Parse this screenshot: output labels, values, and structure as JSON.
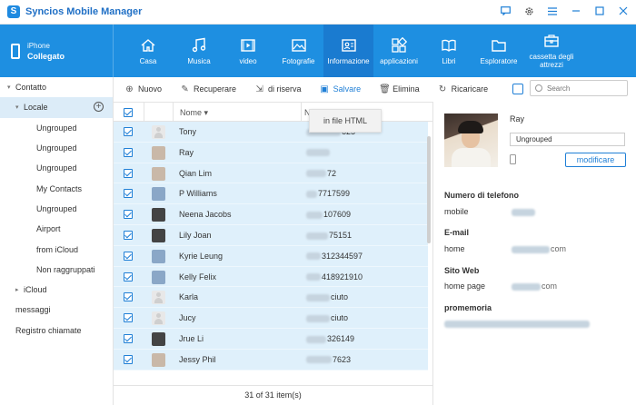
{
  "app": {
    "title": "Syncios Mobile Manager",
    "logo_letter": "S"
  },
  "window_controls": [
    "feedback-icon",
    "settings-icon",
    "menu-icon",
    "minimize-icon",
    "maximize-icon",
    "close-icon"
  ],
  "device": {
    "name": "iPhone",
    "status": "Collegato"
  },
  "nav": [
    {
      "label": "Casa",
      "icon": "home-icon"
    },
    {
      "label": "Musica",
      "icon": "music-icon"
    },
    {
      "label": "video",
      "icon": "video-icon"
    },
    {
      "label": "Fotografie",
      "icon": "photo-icon"
    },
    {
      "label": "Informazione",
      "icon": "contact-card-icon",
      "active": true
    },
    {
      "label": "applicazioni",
      "icon": "apps-icon"
    },
    {
      "label": "Libri",
      "icon": "book-icon"
    },
    {
      "label": "Esploratore",
      "icon": "folder-icon"
    },
    {
      "label_line1": "cassetta degli",
      "label_line2": "attrezzi",
      "icon": "toolbox-icon"
    }
  ],
  "sidebar": {
    "contatto": "Contatto",
    "locale": "Locale",
    "groups": [
      "Ungrouped",
      "Ungrouped",
      "Ungrouped",
      "My Contacts",
      "Ungrouped",
      "Airport",
      "from iCloud",
      "Non raggruppati"
    ],
    "icloud": "iCloud",
    "messaggi": "messaggi",
    "registro": "Registro chiamate"
  },
  "toolbar": {
    "nuovo": "Nuovo",
    "recuperare": "Recuperare",
    "backup": "di riserva",
    "salvare": "Salvare",
    "elimina": "Elimina",
    "ricaricare": "Ricaricare"
  },
  "search": {
    "placeholder": "Search"
  },
  "list": {
    "col_name": "Nome",
    "col_number": "N",
    "rows": [
      {
        "name": "Tony",
        "number_tail": "625",
        "avatar": "default"
      },
      {
        "name": "Ray",
        "number_tail": "",
        "avatar": "photo"
      },
      {
        "name": "Qian Lim",
        "number_tail": "72",
        "avatar": "photo"
      },
      {
        "name": "P Williams",
        "number_tail": "7717599",
        "avatar": "photo"
      },
      {
        "name": "Neena Jacobs",
        "number_tail": "107609",
        "avatar": "photo"
      },
      {
        "name": "Lily Joan",
        "number_tail": "75151",
        "avatar": "photo"
      },
      {
        "name": "Kyrie Leung",
        "number_tail": "312344597",
        "avatar": "photo"
      },
      {
        "name": "Kelly Felix",
        "number_tail": "418921910",
        "avatar": "photo"
      },
      {
        "name": "Karla",
        "number_tail": "ciuto",
        "avatar": "default"
      },
      {
        "name": "Jucy",
        "number_tail": "ciuto",
        "avatar": "default"
      },
      {
        "name": "Jrue Li",
        "number_tail": "326149",
        "avatar": "photo"
      },
      {
        "name": "Jessy Phil",
        "number_tail": "7623",
        "avatar": "photo"
      }
    ],
    "footer": "31 of 31 item(s)"
  },
  "dropdown": {
    "item": "in file HTML"
  },
  "detail": {
    "name": "Ray",
    "group": "Ungrouped",
    "edit_button": "modificare",
    "phone_section": "Numero di telefono",
    "phone_label": "mobile",
    "email_section": "E-mail",
    "email_label": "home",
    "email_value_tail": "com",
    "web_section": "Sito Web",
    "web_label": "home page",
    "web_value_tail": "com",
    "memo_section": "promemoria"
  }
}
